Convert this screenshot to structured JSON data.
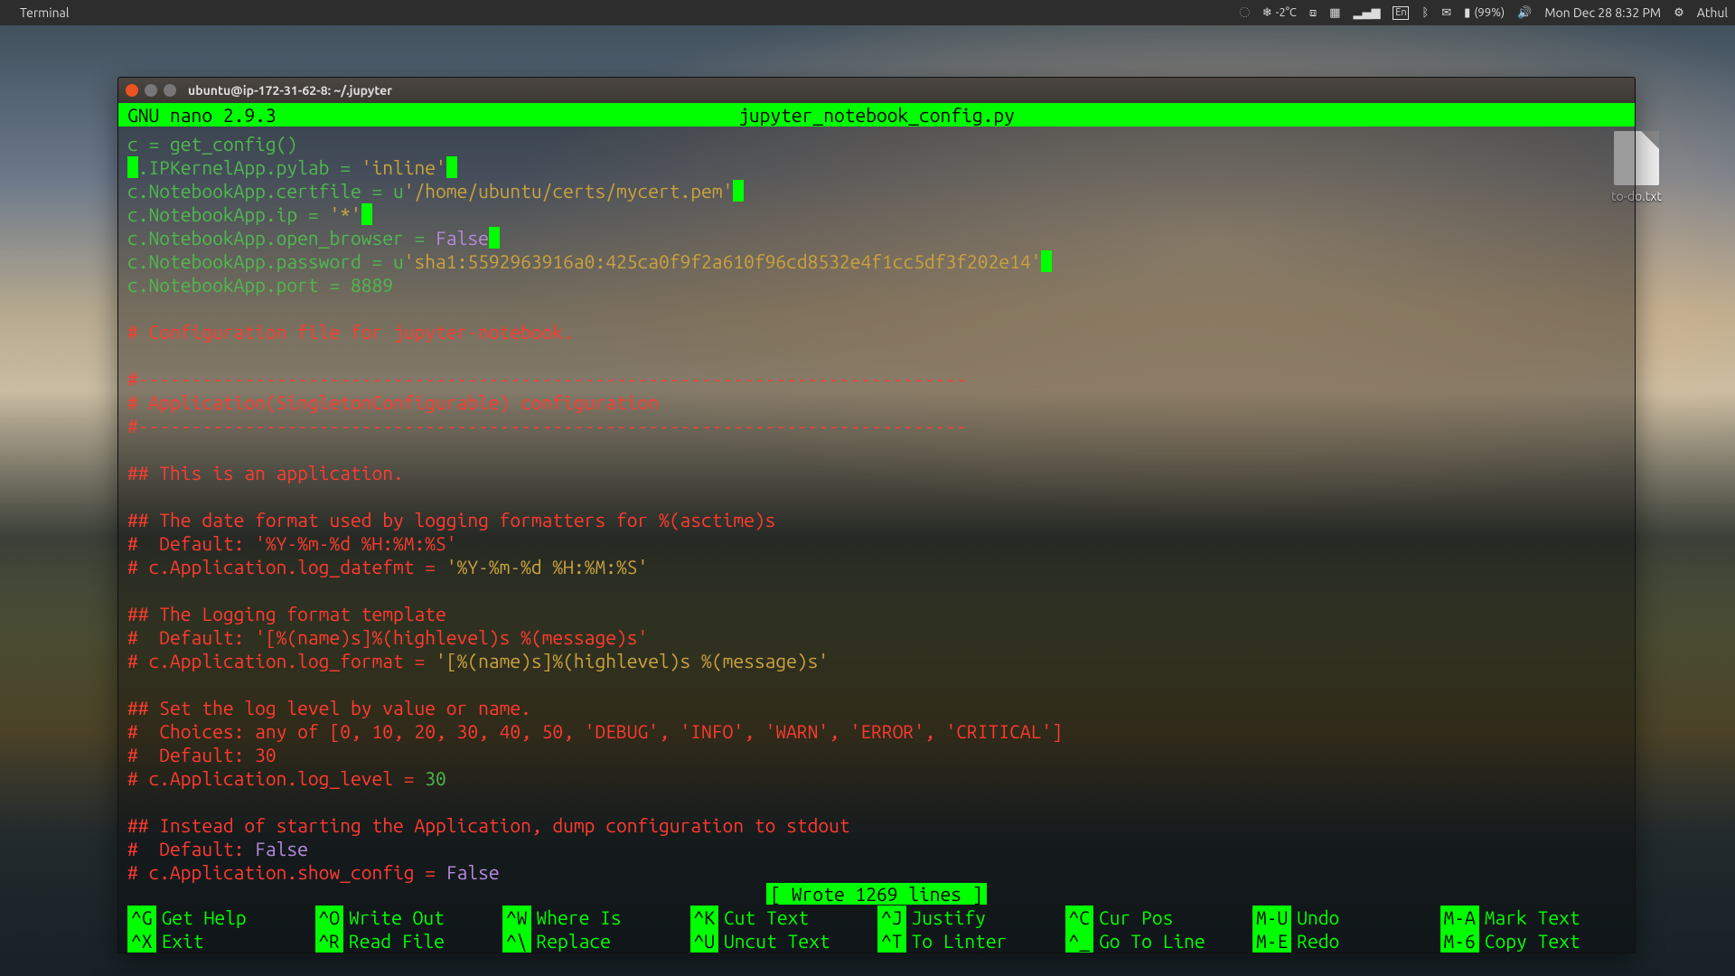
{
  "panel": {
    "app_menu": "Terminal",
    "weather": "-2°C",
    "input_source": "En",
    "battery": "(99%)",
    "clock": "Mon Dec 28  8:32 PM",
    "user": "Athul"
  },
  "desktop": {
    "file_name": "to-do.txt"
  },
  "window": {
    "title": "ubuntu@ip-172-31-62-8: ~/.jupyter"
  },
  "nano": {
    "version": "GNU nano 2.9.3",
    "filename": "jupyter_notebook_config.py",
    "status": "[ Wrote 1269 lines ]",
    "code": {
      "l1a": "c = get_config()",
      "l2a": "c",
      "l2b": ".IPKernelApp.pylab = ",
      "l2c": "'inline'",
      "l3a": "c.NotebookApp.certfile = u",
      "l3b": "'/home/ubuntu/certs/mycert.pem'",
      "l4a": "c.NotebookApp.ip = ",
      "l4b": "'*'",
      "l5a": "c.NotebookApp.open_browser = ",
      "l5b": "False",
      "l6a": "c.NotebookApp.password = u",
      "l6b": "'sha1:5592963916a0:425ca0f9f2a610f96cd8532e4f1cc5df3f202e14'",
      "l7a": "c.NotebookApp.port = ",
      "l7b": "8889",
      "c1": "# Configuration file for jupyter-notebook.",
      "c2": "#------------------------------------------------------------------------------",
      "c3": "# Application(SingletonConfigurable) configuration",
      "c4": "#------------------------------------------------------------------------------",
      "c5": "## This is an application.",
      "c6": "## The date format used by logging formatters for %(asctime)s",
      "c7": "#  Default: '%Y-%m-%d %H:%M:%S'",
      "c8a": "# c.Application.log_datefmt = ",
      "c8b": "'%Y-%m-%d %H:%M:%S'",
      "c9": "## The Logging format template",
      "c10": "#  Default: '[%(name)s]%(highlevel)s %(message)s'",
      "c11a": "# c.Application.log_format = ",
      "c11b": "'[%(name)s]%(highlevel)s %(message)s'",
      "c12": "## Set the log level by value or name.",
      "c13": "#  Choices: any of [0, 10, 20, 30, 40, 50, 'DEBUG', 'INFO', 'WARN', 'ERROR', 'CRITICAL']",
      "c14": "#  Default: 30",
      "c15a": "# c.Application.log_level = ",
      "c15b": "30",
      "c16": "## Instead of starting the Application, dump configuration to stdout",
      "c17a": "#  Default: ",
      "c17b": "False",
      "c18a": "# c.Application.show_config = ",
      "c18b": "False"
    },
    "help": {
      "row1": [
        {
          "k": "^G",
          "l": "Get Help"
        },
        {
          "k": "^O",
          "l": "Write Out"
        },
        {
          "k": "^W",
          "l": "Where Is"
        },
        {
          "k": "^K",
          "l": "Cut Text"
        },
        {
          "k": "^J",
          "l": "Justify"
        },
        {
          "k": "^C",
          "l": "Cur Pos"
        },
        {
          "k": "M-U",
          "l": "Undo"
        }
      ],
      "row1_extra": {
        "k": "M-A",
        "l": "Mark Text"
      },
      "row2": [
        {
          "k": "^X",
          "l": "Exit"
        },
        {
          "k": "^R",
          "l": "Read File"
        },
        {
          "k": "^\\",
          "l": "Replace"
        },
        {
          "k": "^U",
          "l": "Uncut Text"
        },
        {
          "k": "^T",
          "l": "To Linter"
        },
        {
          "k": "^_",
          "l": "Go To Line"
        },
        {
          "k": "M-E",
          "l": "Redo"
        }
      ],
      "row2_extra": {
        "k": "M-6",
        "l": "Copy Text"
      }
    }
  }
}
